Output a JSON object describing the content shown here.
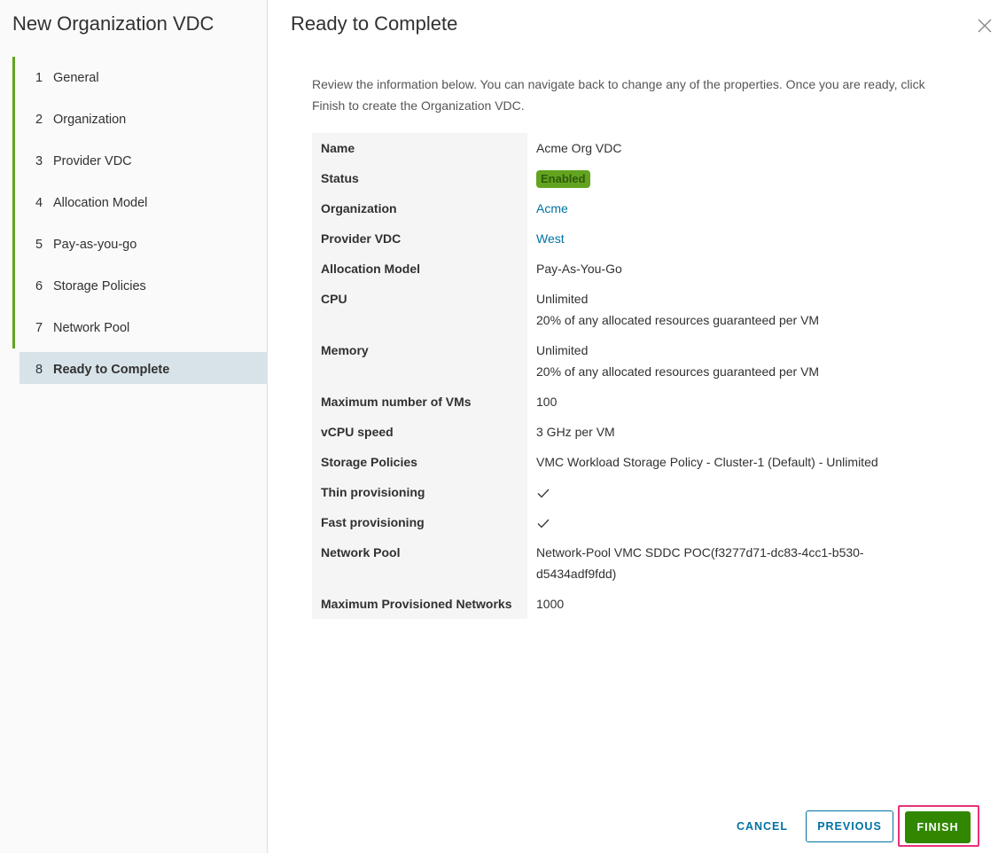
{
  "sidebar": {
    "title": "New Organization VDC",
    "steps": [
      {
        "num": "1",
        "label": "General"
      },
      {
        "num": "2",
        "label": "Organization"
      },
      {
        "num": "3",
        "label": "Provider VDC"
      },
      {
        "num": "4",
        "label": "Allocation Model"
      },
      {
        "num": "5",
        "label": "Pay-as-you-go"
      },
      {
        "num": "6",
        "label": "Storage Policies"
      },
      {
        "num": "7",
        "label": "Network Pool"
      },
      {
        "num": "8",
        "label": "Ready to Complete"
      }
    ],
    "active_step": 8,
    "completed_color": "#62a420"
  },
  "main": {
    "title": "Ready to Complete",
    "close_icon": "close-icon",
    "intro": "Review the information below. You can navigate back to change any of the properties. Once you are ready, click Finish to create the Organization VDC.",
    "summary": {
      "name": {
        "key": "Name",
        "value": "Acme Org VDC"
      },
      "status": {
        "key": "Status",
        "value": "Enabled",
        "color": "#62a420"
      },
      "organization": {
        "key": "Organization",
        "value": "Acme"
      },
      "provider_vdc": {
        "key": "Provider VDC",
        "value": "West"
      },
      "allocation_model": {
        "key": "Allocation Model",
        "value": "Pay-As-You-Go"
      },
      "cpu": {
        "key": "CPU",
        "line1": "Unlimited",
        "line2": "20% of any allocated resources guaranteed per VM"
      },
      "memory": {
        "key": "Memory",
        "line1": "Unlimited",
        "line2": "20% of any allocated resources guaranteed per VM"
      },
      "max_vms": {
        "key": "Maximum number of VMs",
        "value": "100"
      },
      "vcpu_speed": {
        "key": "vCPU speed",
        "value": "3 GHz per VM"
      },
      "storage_policies": {
        "key": "Storage Policies",
        "value": "VMC Workload Storage Policy - Cluster-1 (Default) - Unlimited"
      },
      "thin_provisioning": {
        "key": "Thin provisioning",
        "icon": "check-icon"
      },
      "fast_provisioning": {
        "key": "Fast provisioning",
        "icon": "check-icon"
      },
      "network_pool": {
        "key": "Network Pool",
        "line1": "Network-Pool VMC SDDC POC(f3277d71-dc83-4cc1-b530-",
        "line2": "d5434adf9fdd)"
      },
      "max_networks": {
        "key": "Maximum Provisioned Networks",
        "value": "1000"
      }
    }
  },
  "footer": {
    "cancel_label": "CANCEL",
    "previous_label": "PREVIOUS",
    "finish_label": "FINISH",
    "link_color": "#0072a3",
    "finish_color": "#318700",
    "highlight_color": "#e8307a"
  }
}
